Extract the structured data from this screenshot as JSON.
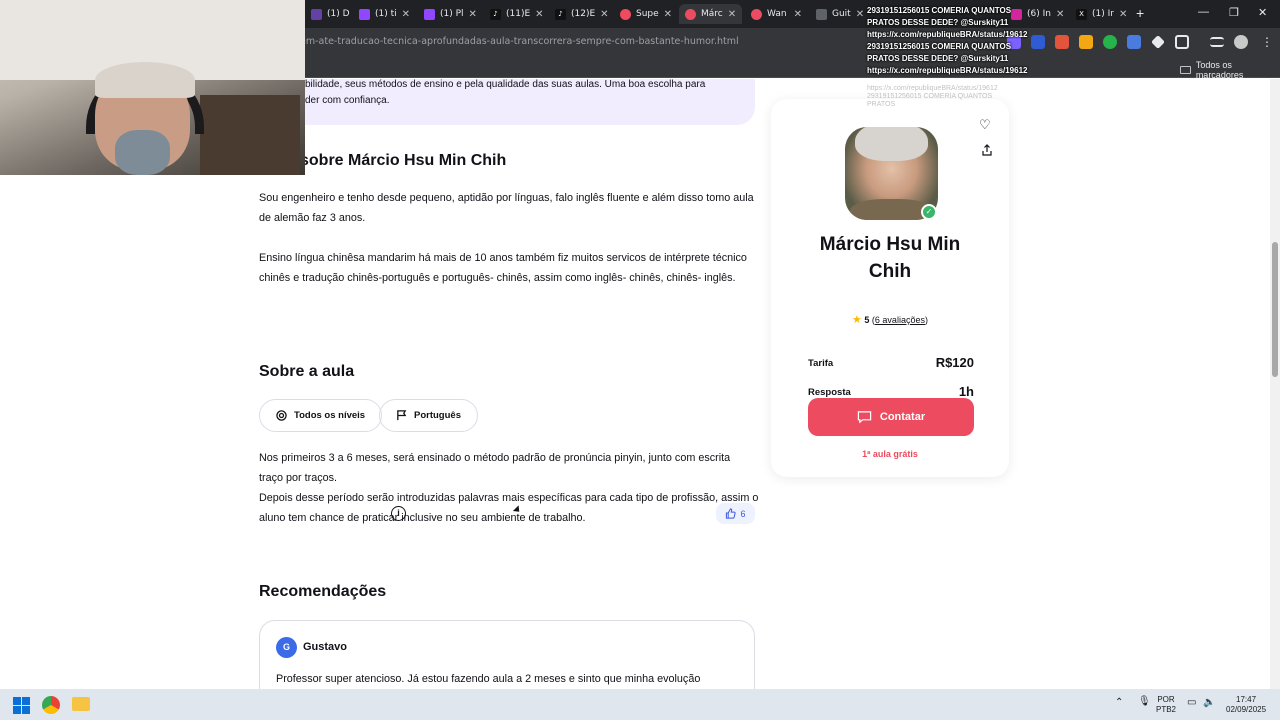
{
  "browser": {
    "tabs": [
      {
        "label": "(1) D",
        "color": "#6441a5"
      },
      {
        "label": "(1) ti",
        "color": "#9146ff"
      },
      {
        "label": "(1) Pl",
        "color": "#9146ff"
      },
      {
        "label": "(11)E",
        "color": "#111111"
      },
      {
        "label": "(12)E",
        "color": "#111111"
      },
      {
        "label": "Supe",
        "color": "#ed4b5f"
      },
      {
        "label": "Márc",
        "color": "#ed4b5f"
      },
      {
        "label": "Wan",
        "color": "#ed4b5f"
      },
      {
        "label": "Guit",
        "color": "#5f6368"
      }
    ],
    "extra_tabs": [
      {
        "label": "(6) In",
        "color": "#d6249f"
      },
      {
        "label": "(1) Ir",
        "color": "#111111"
      }
    ],
    "url": "em-ate-traducao-tecnica-aprofundadas-aula-transcorrera-sempre-com-bastante-humor.html",
    "bookmarks_label": "Todos os marcadores"
  },
  "tweet_overlay": {
    "text": "29319151256015 COMERIA QUANTOS\nPRATOS DESSE DEDE? @Surskity11\nhttps://x.com/republiqueBRA/status/19612\n29319151256015 COMERIA QUANTOS\nPRATOS DESSE DEDE? @Surskity11\nhttps://x.com/republiqueBRA/status/19612",
    "faded": "https://x.com/republiqueBRA/status/19612\n29319151256015 COMERIA QUANTOS\nPRATOS"
  },
  "banner": {
    "text": "bilidade, seus métodos de ensino e pela qualidade das suas aulas. Uma boa escolha para\nder com confiança."
  },
  "about": {
    "heading": "sobre Márcio Hsu Min Chih",
    "paragraph1": "Sou engenheiro e tenho desde pequeno, aptidão por línguas, falo inglês fluente e além disso tomo aula de alemão faz 3 anos.",
    "paragraph2": "Ensino língua chinêsa mandarim há mais de 10 anos também fiz muitos servicos de intérprete técnico chinês e tradução chinês-português e português- chinês, assim como inglês- chinês, chinês- inglês."
  },
  "lesson": {
    "heading": "Sobre a aula",
    "level_pill": "Todos os níveis",
    "language_pill": "Português",
    "paragraph1": "Nos primeiros 3 a 6 meses, será ensinado o método padrão de pronúncia pinyin, junto com escrita traço por traços.",
    "paragraph2": "Depois desse período serão introduzidas palavras mais específicas para cada tipo de profissão, assim o aluno tem chance de praticar inclusive no seu ambiente de trabalho."
  },
  "recommendations": {
    "heading": "Recomendações",
    "likes": "6",
    "review": {
      "initial": "G",
      "name": "Gustavo",
      "text": "Professor super atencioso. Já estou fazendo aula a 2 meses e sinto que minha evolução"
    }
  },
  "teacher_card": {
    "name": "Márcio Hsu Min Chih",
    "rating": "5",
    "reviews_link": "6 avaliações",
    "rate_label": "Tarifa",
    "rate_value": "R$120",
    "response_label": "Resposta",
    "response_value": "1h",
    "contact_label": "Contatar",
    "free_lesson": "1ª aula grátis"
  },
  "taskbar": {
    "lang_top": "POR",
    "lang_bottom": "PTB2",
    "time": "17:47",
    "date": "02/09/2025"
  },
  "colors": {
    "accent": "#ed4b5f",
    "banner_bg": "#f1edff",
    "link_blue": "#3c5ad6"
  }
}
